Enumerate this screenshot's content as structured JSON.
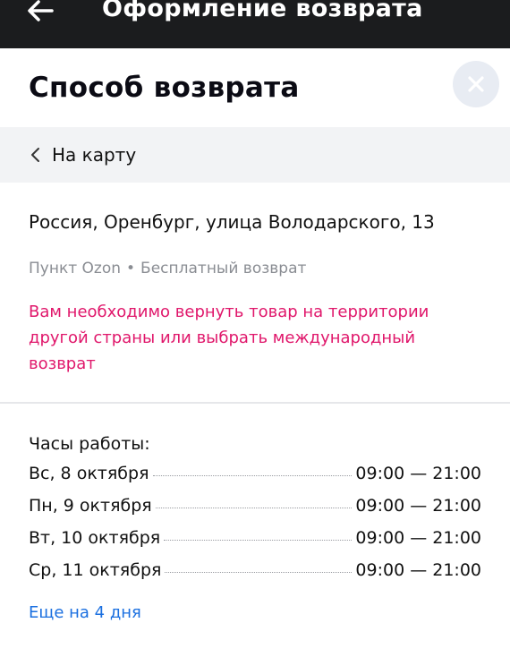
{
  "topbar": {
    "title": "Оформление возврата"
  },
  "sheet": {
    "title": "Способ возврата"
  },
  "back_bar": {
    "label": "На карту"
  },
  "point": {
    "address": "Россия, Оренбург, улица Володарского, 13",
    "type": "Пункт Ozon",
    "separator": "•",
    "return_type": "Бесплатный возврат",
    "warning": "Вам необходимо вернуть товар на территории другой страны или выбрать международный возврат"
  },
  "hours": {
    "title": "Часы работы:",
    "rows": [
      {
        "day": "Вс, 8 октября",
        "time": "09:00 — 21:00"
      },
      {
        "day": "Пн, 9 октября",
        "time": "09:00 — 21:00"
      },
      {
        "day": "Вт, 10 октября",
        "time": "09:00 — 21:00"
      },
      {
        "day": "Ср, 11 октября",
        "time": "09:00 — 21:00"
      }
    ],
    "more_link": "Еще на 4 дня"
  },
  "colors": {
    "topbar_bg": "#1b1c1e",
    "warning": "#e0176b",
    "link": "#1a6fe0",
    "close_bg": "#e8ecf3"
  },
  "icons": {
    "back": "arrow-left-icon",
    "close": "close-icon",
    "chevron": "chevron-left-icon"
  }
}
